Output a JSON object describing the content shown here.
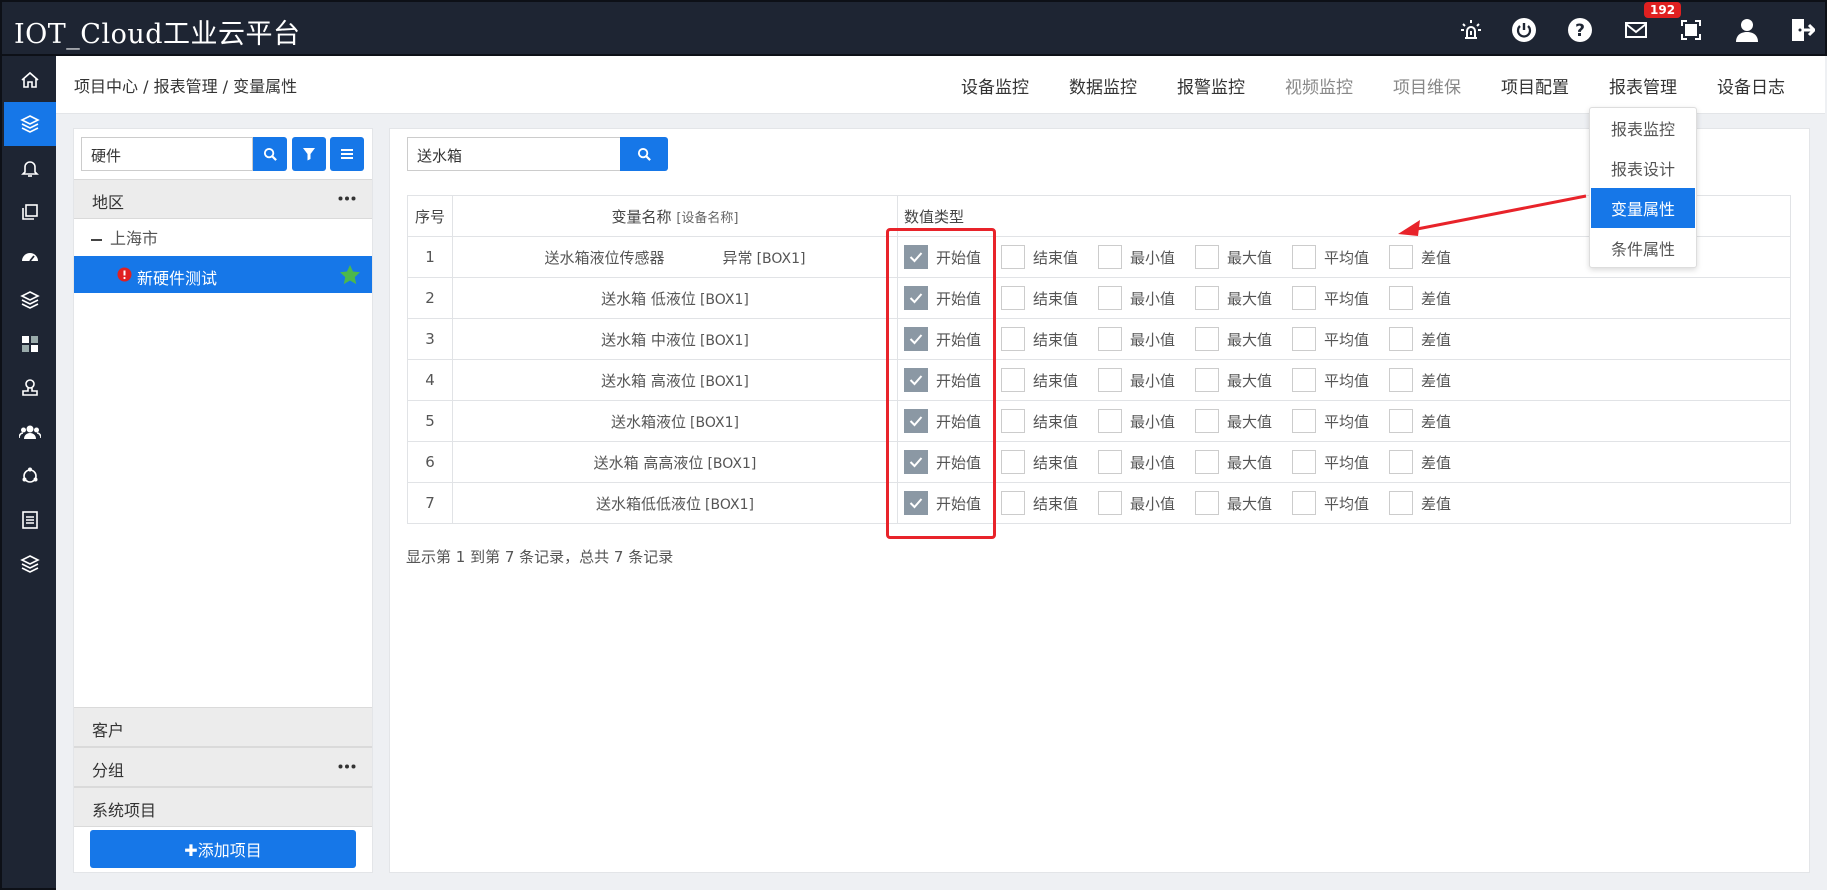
{
  "app": {
    "title": "IOT_Cloud工业云平台",
    "mail_badge": "192"
  },
  "header_icons": [
    "alarm-light-icon",
    "power-icon",
    "help-icon",
    "mail-icon",
    "fullscreen-icon",
    "user-icon",
    "logout-icon"
  ],
  "sidebar": {
    "icons": [
      "home-icon",
      "layers-icon",
      "bell-icon",
      "copy-icon",
      "dashboard-icon",
      "layers-icon",
      "grid-icon",
      "stamp-icon",
      "group-icon",
      "sync-icon",
      "list-icon",
      "layers-icon"
    ],
    "active_index": 1
  },
  "breadcrumb": "项目中心 / 报表管理 / 变量属性",
  "top_menu": [
    "设备监控",
    "数据监控",
    "报警监控",
    "视频监控",
    "项目维保",
    "项目配置",
    "报表管理",
    "设备日志"
  ],
  "report_dropdown": {
    "items": [
      "报表监控",
      "报表设计",
      "变量属性",
      "条件属性"
    ],
    "selected": "变量属性"
  },
  "left_panel": {
    "search_value": "硬件",
    "region_title": "地区",
    "tree_parent": "上海市",
    "tree_selected": "新硬件测试",
    "sections": [
      "客户",
      "分组",
      "系统项目"
    ],
    "add_button": "✚添加项目"
  },
  "main": {
    "search_value": "送水箱",
    "columns": {
      "seq": "序号",
      "name": "变量名称",
      "name_sub": "[设备名称]",
      "type": "数值类型"
    },
    "value_types": [
      "开始值",
      "结束值",
      "最小值",
      "最大值",
      "平均值",
      "差值"
    ],
    "rows": [
      {
        "seq": "1",
        "name": "送水箱液位传感器",
        "status": "异常",
        "device": "[BOX1]",
        "checked": [
          "开始值"
        ]
      },
      {
        "seq": "2",
        "name": "送水箱 低液位",
        "status": "",
        "device": "[BOX1]",
        "checked": [
          "开始值"
        ]
      },
      {
        "seq": "3",
        "name": "送水箱 中液位",
        "status": "",
        "device": "[BOX1]",
        "checked": [
          "开始值"
        ]
      },
      {
        "seq": "4",
        "name": "送水箱 高液位",
        "status": "",
        "device": "[BOX1]",
        "checked": [
          "开始值"
        ]
      },
      {
        "seq": "5",
        "name": "送水箱液位",
        "status": "",
        "device": "[BOX1]",
        "checked": [
          "开始值"
        ]
      },
      {
        "seq": "6",
        "name": "送水箱 高高液位",
        "status": "",
        "device": "[BOX1]",
        "checked": [
          "开始值"
        ]
      },
      {
        "seq": "7",
        "name": "送水箱低低液位",
        "status": "",
        "device": "[BOX1]",
        "checked": [
          "开始值"
        ]
      }
    ],
    "record_summary": "显示第 1 到第 7 条记录，总共 7 条记录"
  },
  "colors": {
    "accent": "#1677e8",
    "header_bg": "#1e2533",
    "annotation_red": "#e8232a",
    "checked_box": "#8b98a4"
  }
}
